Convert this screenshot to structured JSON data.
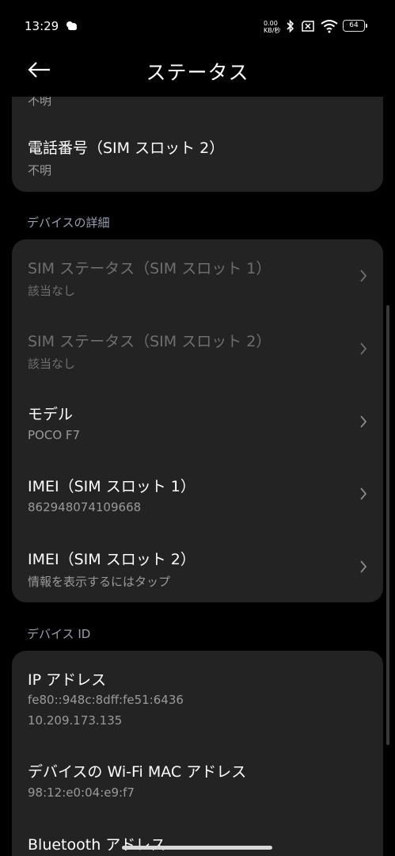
{
  "status": {
    "time": "13:29",
    "net_speed_top": "0.00",
    "net_speed_bottom": "KB/秒",
    "battery": "64"
  },
  "header": {
    "title": "ステータス",
    "back_icon": "arrow-left-icon"
  },
  "card1": {
    "partial_value": "不明",
    "rows": [
      {
        "title": "電話番号（SIM スロット 2）",
        "subtitle": "不明"
      }
    ]
  },
  "section_device_details": "デバイスの詳細",
  "card2": {
    "rows": [
      {
        "title": "SIM ステータス（SIM スロット 1）",
        "subtitle": "該当なし"
      },
      {
        "title": "SIM ステータス（SIM スロット 2）",
        "subtitle": "該当なし"
      },
      {
        "title": "モデル",
        "subtitle": "POCO F7"
      },
      {
        "title": "IMEI（SIM スロット 1）",
        "subtitle": "862948074109668"
      },
      {
        "title": "IMEI（SIM スロット 2）",
        "subtitle": "情報を表示するにはタップ"
      }
    ]
  },
  "section_device_id": "デバイス ID",
  "card3": {
    "rows": [
      {
        "title": "IP アドレス",
        "subtitle": "fe80::948c:8dff:fe51:6436",
        "subtitle2": "10.209.173.135"
      },
      {
        "title": "デバイスの Wi-Fi MAC アドレス",
        "subtitle": "98:12:e0:04:e9:f7"
      },
      {
        "title": "Bluetooth アドレス"
      }
    ]
  },
  "colors": {
    "background": "#000000",
    "card": "#232323",
    "section": "#9aa0b4",
    "secondary_text": "#9a9a9a",
    "disabled_text": "#6f6f6f"
  }
}
